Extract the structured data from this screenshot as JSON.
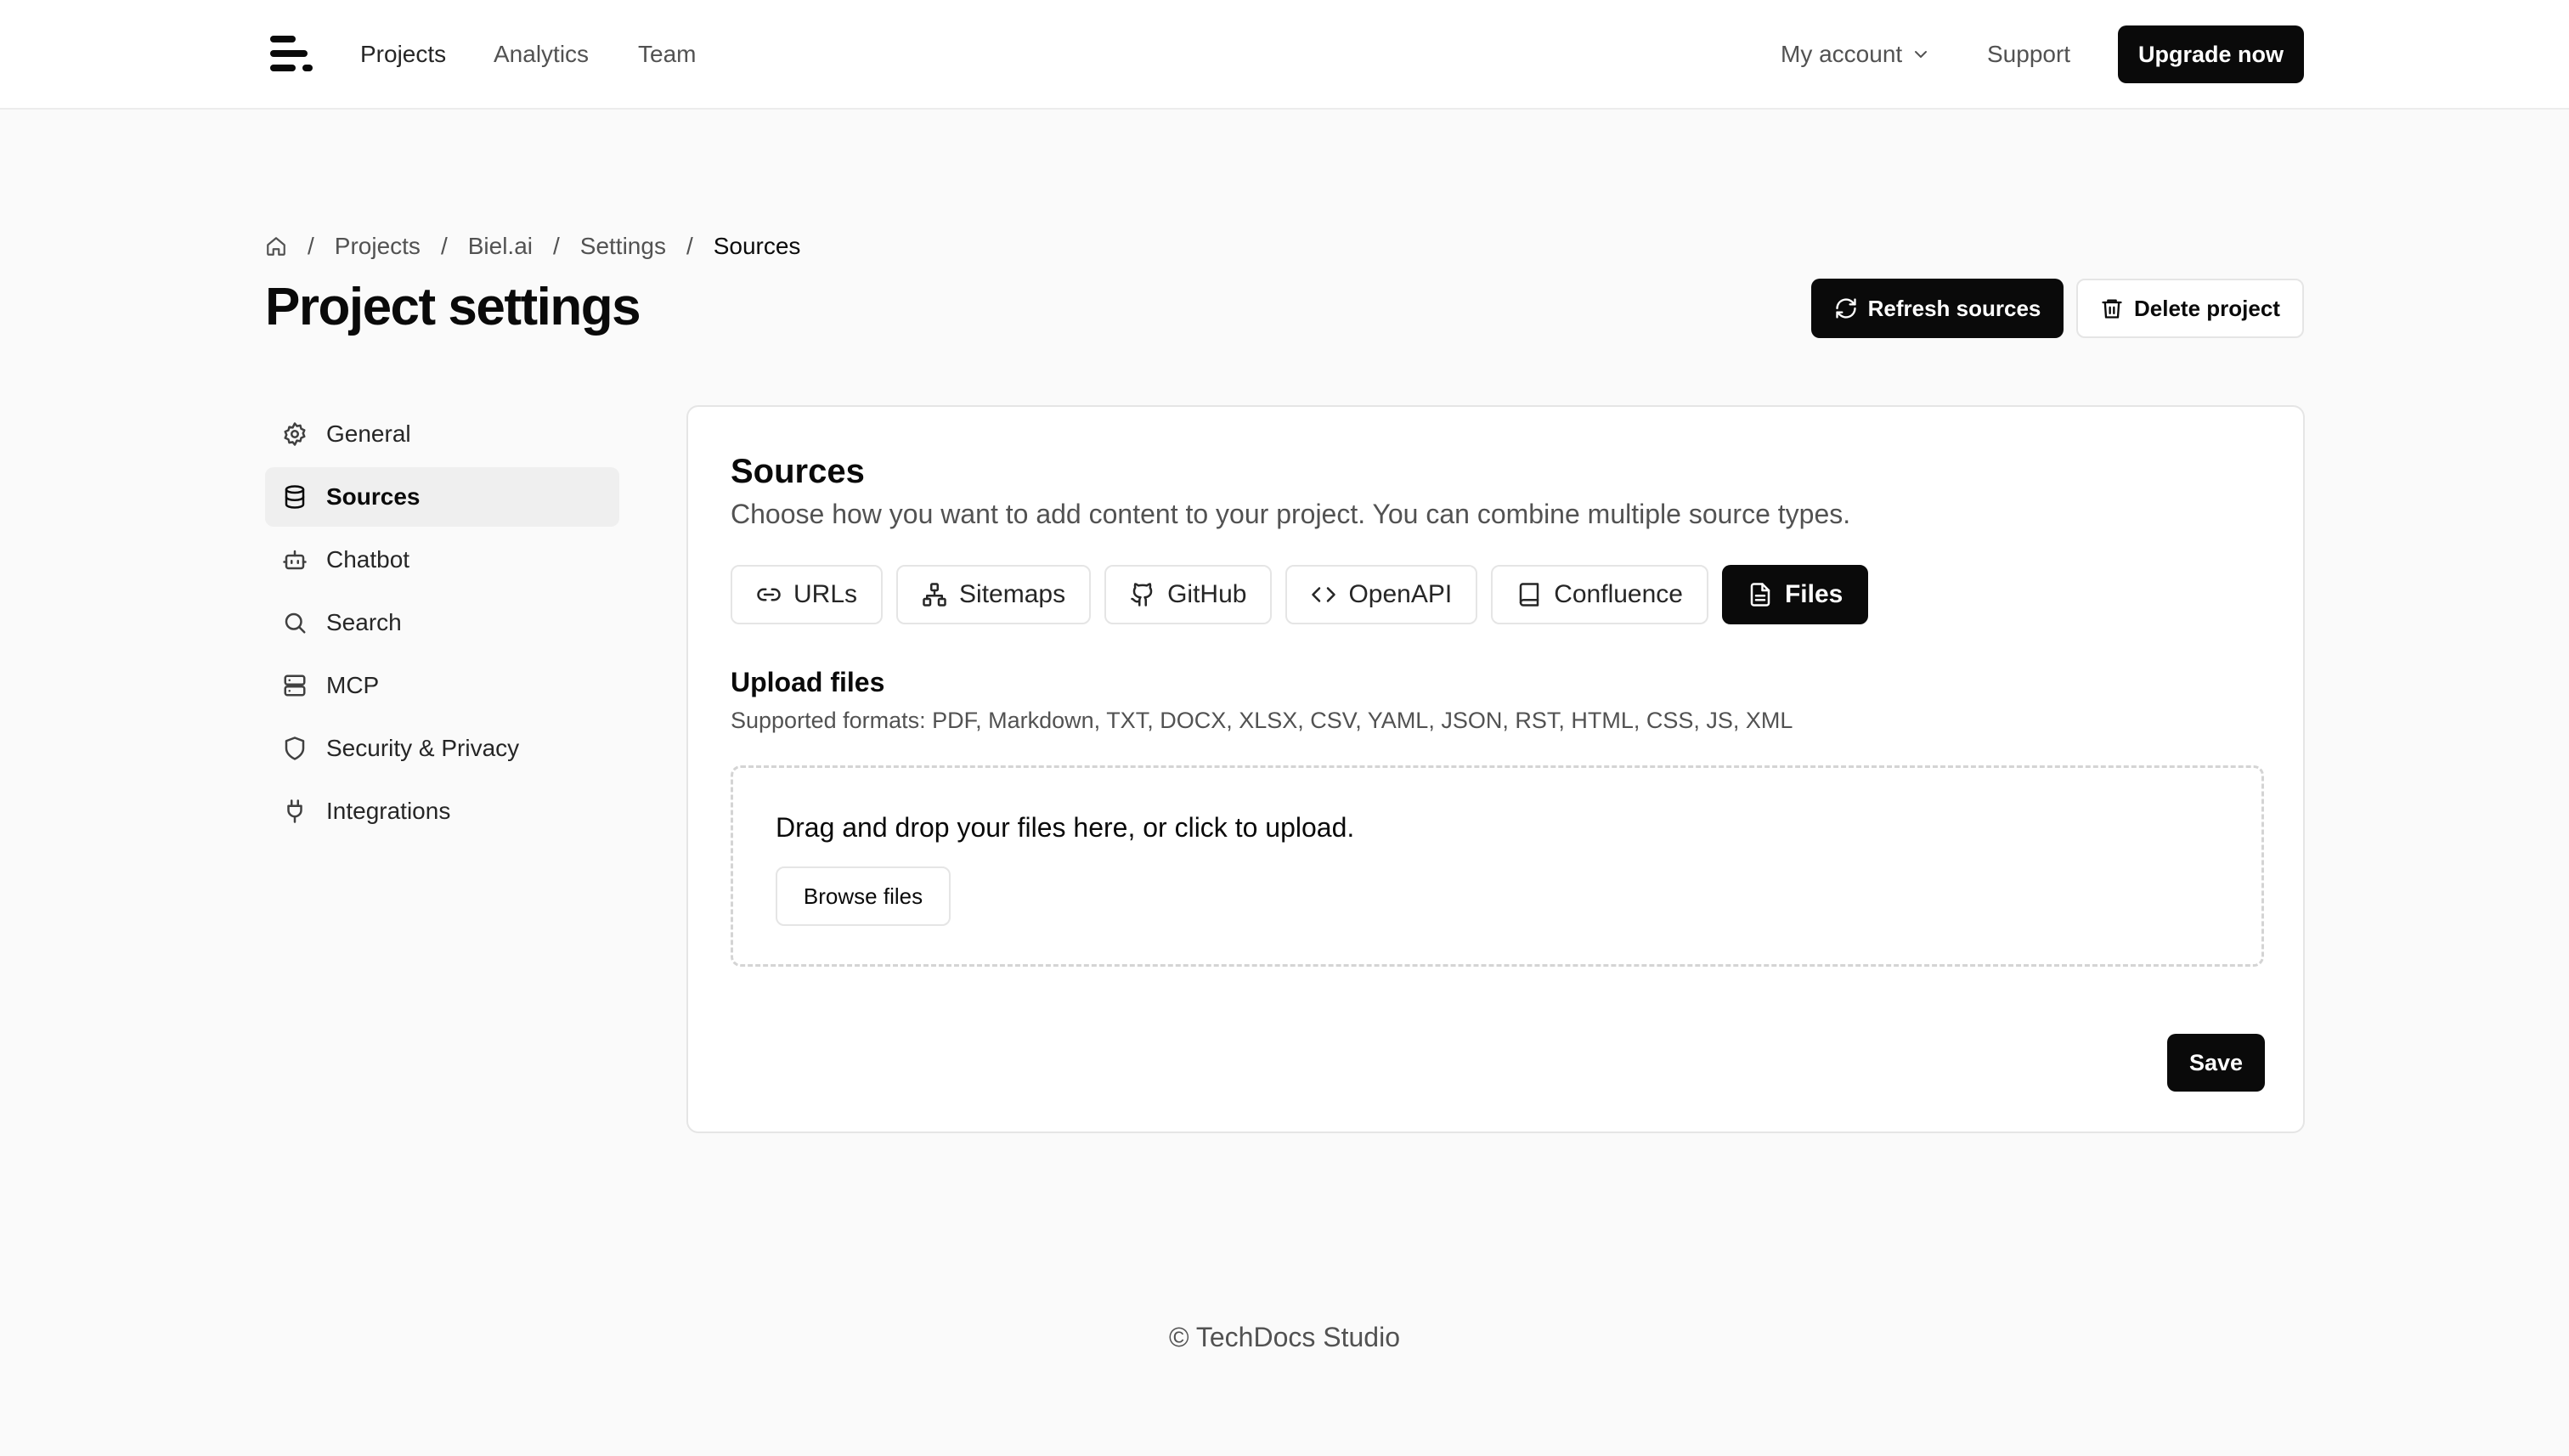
{
  "nav": {
    "links": [
      "Projects",
      "Analytics",
      "Team"
    ],
    "account_label": "My account",
    "support_label": "Support",
    "upgrade_label": "Upgrade now"
  },
  "breadcrumb": {
    "items": [
      "Projects",
      "Biel.ai",
      "Settings"
    ],
    "current": "Sources",
    "separator": "/"
  },
  "header": {
    "title": "Project settings",
    "refresh_label": "Refresh sources",
    "delete_label": "Delete project"
  },
  "sidebar": {
    "items": [
      {
        "label": "General",
        "icon": "gear-icon"
      },
      {
        "label": "Sources",
        "icon": "database-icon",
        "active": true
      },
      {
        "label": "Chatbot",
        "icon": "bot-icon"
      },
      {
        "label": "Search",
        "icon": "search-icon"
      },
      {
        "label": "MCP",
        "icon": "server-icon"
      },
      {
        "label": "Security & Privacy",
        "icon": "shield-icon"
      },
      {
        "label": "Integrations",
        "icon": "plug-icon"
      }
    ]
  },
  "main": {
    "title": "Sources",
    "description": "Choose how you want to add content to your project. You can combine multiple source types.",
    "tabs": [
      {
        "label": "URLs",
        "icon": "link-icon"
      },
      {
        "label": "Sitemaps",
        "icon": "sitemap-icon"
      },
      {
        "label": "GitHub",
        "icon": "github-icon"
      },
      {
        "label": "OpenAPI",
        "icon": "code-icon"
      },
      {
        "label": "Confluence",
        "icon": "book-icon"
      },
      {
        "label": "Files",
        "icon": "file-icon",
        "active": true
      }
    ],
    "upload_title": "Upload files",
    "upload_formats": "Supported formats: PDF, Markdown, TXT, DOCX, XLSX, CSV, YAML, JSON, RST, HTML, CSS, JS, XML",
    "dropzone_text": "Drag and drop your files here, or click to upload.",
    "browse_label": "Browse files",
    "save_label": "Save"
  },
  "footer": {
    "text": "© TechDocs Studio"
  },
  "colors": {
    "primary": "#0a0a0a",
    "background": "#fafafa",
    "border": "#e5e5e5",
    "muted_text": "#525252"
  }
}
